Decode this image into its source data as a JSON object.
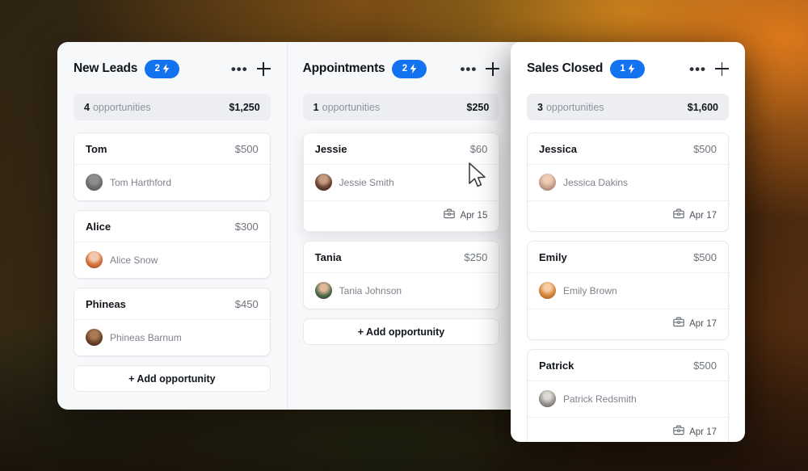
{
  "theme": {
    "accent": "#1272f0",
    "panel_bg": "#f7f8fa",
    "card_bg": "#ffffff",
    "summary_bg": "#eceef2",
    "title_color": "#11161d",
    "muted_color": "#8d939d"
  },
  "columns": [
    {
      "title": "New Leads",
      "badge_count": "2",
      "badge_icon": "lightning-bolt-icon",
      "more_icon": "ellipsis-icon",
      "add_icon": "plus-icon",
      "summary": {
        "count": "4",
        "label": "opportunities",
        "amount": "$1,250"
      },
      "add_label": "+ Add opportunity",
      "cards": [
        {
          "name": "Tom",
          "price": "$500",
          "person": "Tom Harthford",
          "avatar": "avatar-tom",
          "date": null
        },
        {
          "name": "Alice",
          "price": "$300",
          "person": "Alice Snow",
          "avatar": "avatar-alice",
          "date": null
        },
        {
          "name": "Phineas",
          "price": "$450",
          "person": "Phineas Barnum",
          "avatar": "avatar-phineas",
          "date": null
        }
      ]
    },
    {
      "title": "Appointments",
      "badge_count": "2",
      "badge_icon": "lightning-bolt-icon",
      "more_icon": "ellipsis-icon",
      "add_icon": "plus-icon",
      "summary": {
        "count": "1",
        "label": "opportunities",
        "amount": "$250"
      },
      "add_label": "+ Add opportunity",
      "cards": [
        {
          "name": "Jessie",
          "price": "$60",
          "person": "Jessie Smith",
          "avatar": "avatar-jessie",
          "date": "Apr 15",
          "date_icon": "briefcase-icon",
          "elevated": true
        },
        {
          "name": "Tania",
          "price": "$250",
          "person": "Tania Johnson",
          "avatar": "avatar-tania",
          "date": null
        }
      ]
    },
    {
      "title": "Sales Closed",
      "badge_count": "1",
      "badge_icon": "lightning-bolt-icon",
      "more_icon": "ellipsis-icon",
      "add_icon": "plus-icon",
      "summary": {
        "count": "3",
        "label": "opportunities",
        "amount": "$1,600"
      },
      "add_label": null,
      "cards": [
        {
          "name": "Jessica",
          "price": "$500",
          "person": "Jessica Dakins",
          "avatar": "avatar-jessica",
          "date": "Apr 17",
          "date_icon": "briefcase-icon"
        },
        {
          "name": "Emily",
          "price": "$500",
          "person": "Emily Brown",
          "avatar": "avatar-emily",
          "date": "Apr 17",
          "date_icon": "briefcase-icon"
        },
        {
          "name": "Patrick",
          "price": "$500",
          "person": "Patrick Redsmith",
          "avatar": "avatar-patrick",
          "date": "Apr 17",
          "date_icon": "briefcase-icon"
        }
      ]
    }
  ],
  "cursor": {
    "icon": "mouse-pointer-icon"
  }
}
